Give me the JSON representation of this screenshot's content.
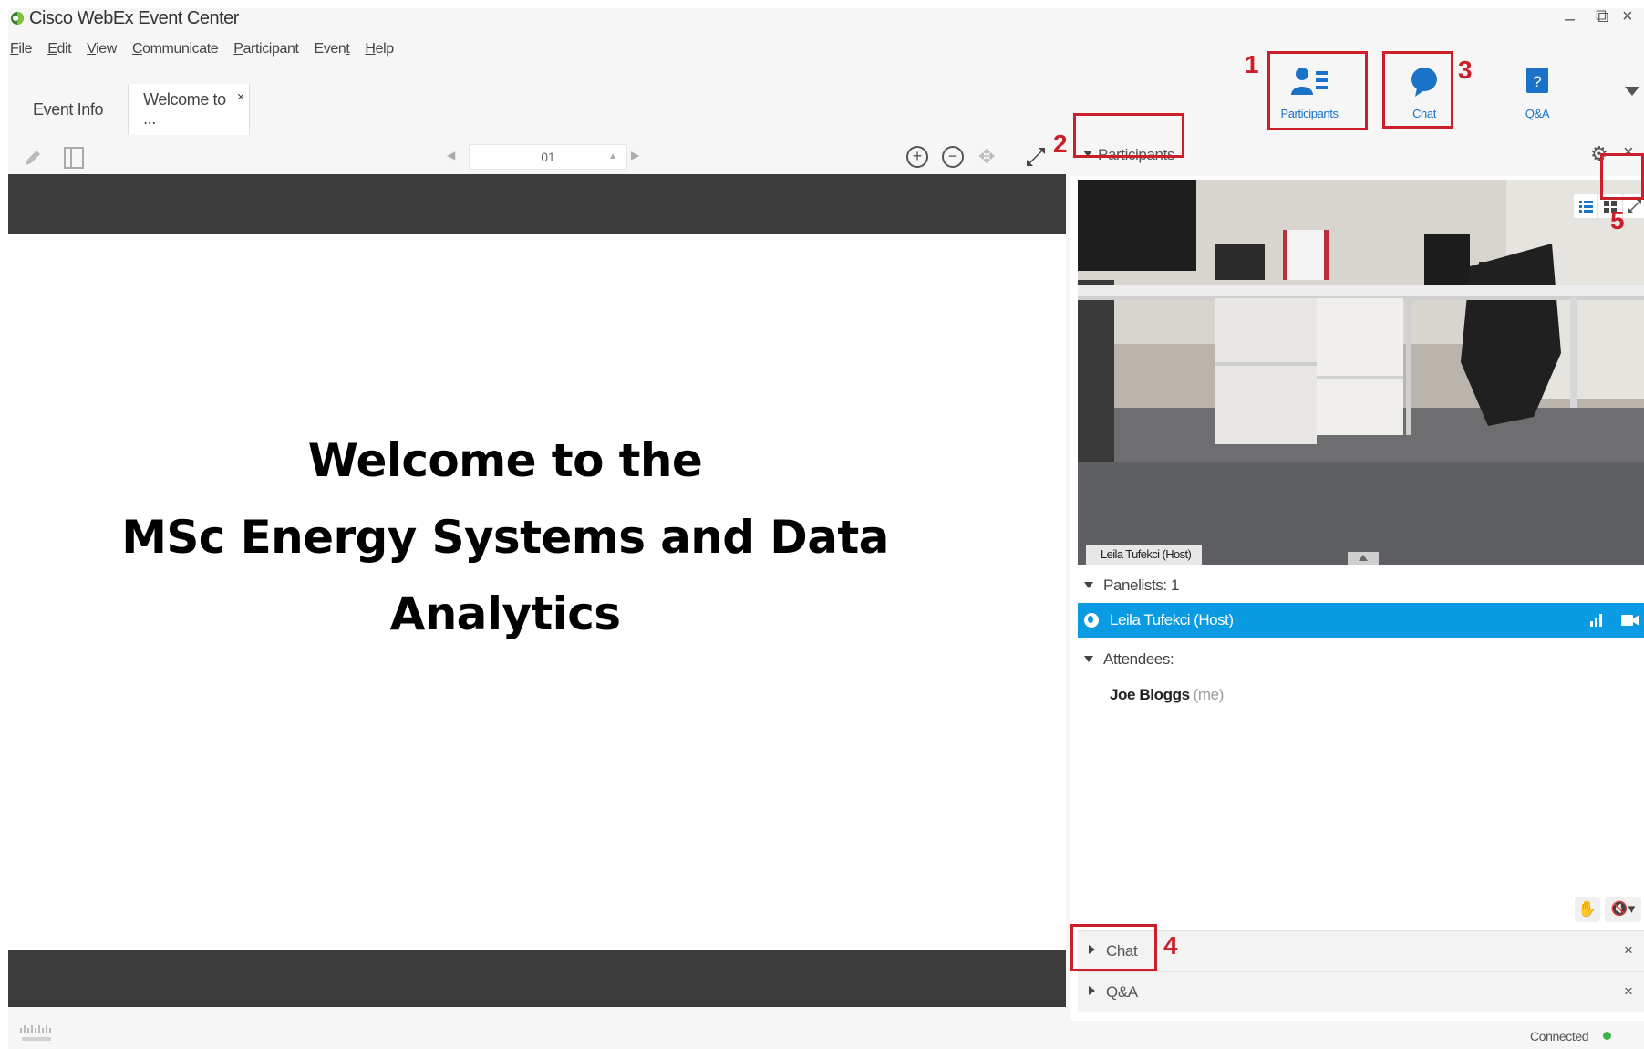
{
  "window": {
    "title": "Cisco WebEx Event Center",
    "controls": {
      "minimize": "–",
      "maximize": "⧉",
      "close": "×"
    }
  },
  "menu": {
    "items": [
      {
        "accel": "F",
        "rest": "ile"
      },
      {
        "accel": "E",
        "rest": "dit"
      },
      {
        "accel": "V",
        "rest": "iew"
      },
      {
        "accel": "C",
        "rest": "ommunicate"
      },
      {
        "accel": "P",
        "rest": "articipant"
      },
      {
        "pre": "Even",
        "accel": "t"
      },
      {
        "accel": "H",
        "rest": "elp"
      }
    ]
  },
  "tabs": [
    {
      "label": "Event Info",
      "active": false
    },
    {
      "label": "Welcome to ...",
      "active": true,
      "close": "×"
    }
  ],
  "panel_buttons": {
    "participants": "Participants",
    "chat": "Chat",
    "qa": "Q&A"
  },
  "callout_numbers": [
    "1",
    "2",
    "3",
    "4",
    "5"
  ],
  "content_toolbar": {
    "page_number": "01",
    "zoom_in": "+",
    "zoom_out": "−"
  },
  "slide": {
    "line1": "Welcome to the",
    "line2": "MSc Energy Systems and Data",
    "line3": "Analytics"
  },
  "participants_panel": {
    "title": "Participants",
    "video_caption": "Leila Tufekci (Host)",
    "panelists_label": "Panelists: 1",
    "host_name": "Leila Tufekci (Host)",
    "attendees_label": "Attendees:",
    "attendee_name": "Joe Bloggs",
    "attendee_tag": "(me)"
  },
  "collapsed_panels": {
    "chat": "Chat",
    "qa": "Q&A",
    "close": "×"
  },
  "status": {
    "text": "Connected",
    "color": "#39b54a"
  },
  "colors": {
    "accent_blue": "#0a9be3",
    "link_blue": "#1a73c9",
    "callout_red": "#cc1f2a",
    "slide_band": "#3c3c3c"
  }
}
